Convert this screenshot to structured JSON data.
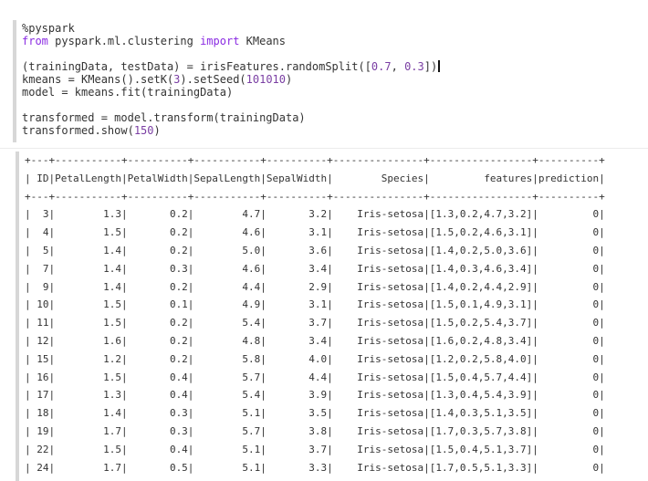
{
  "editor": {
    "lines": [
      [
        {
          "t": "%pyspark",
          "c": "fn"
        }
      ],
      [
        {
          "t": "from",
          "c": "kw"
        },
        {
          "t": " pyspark.ml.clustering ",
          "c": "fn"
        },
        {
          "t": "import",
          "c": "kw"
        },
        {
          "t": " KMeans",
          "c": "fn"
        }
      ],
      [
        {
          "t": "",
          "c": "fn"
        }
      ],
      [
        {
          "t": "(trainingData, testData) = irisFeatures.randomSplit(",
          "c": "fn"
        },
        {
          "t": "[",
          "c": "paren"
        },
        {
          "t": "0.7",
          "c": "num"
        },
        {
          "t": ", ",
          "c": "fn"
        },
        {
          "t": "0.3",
          "c": "num"
        },
        {
          "t": "])",
          "c": "paren"
        }
      ],
      [
        {
          "t": "kmeans = KMeans().setK(",
          "c": "fn"
        },
        {
          "t": "3",
          "c": "num"
        },
        {
          "t": ").setSeed(",
          "c": "fn"
        },
        {
          "t": "101010",
          "c": "num"
        },
        {
          "t": ")",
          "c": "fn"
        }
      ],
      [
        {
          "t": "model = kmeans.fit(trainingData)",
          "c": "fn"
        }
      ],
      [
        {
          "t": "",
          "c": "fn"
        }
      ],
      [
        {
          "t": "transformed = model.transform(trainingData)",
          "c": "fn"
        }
      ],
      [
        {
          "t": "transformed.show(",
          "c": "fn"
        },
        {
          "t": "150",
          "c": "num"
        },
        {
          "t": ")",
          "c": "fn"
        }
      ]
    ],
    "cursor_line": 3
  },
  "output": {
    "separator": "+---+-----------+----------+-----------+----------+---------------+-----------------+----------+",
    "header": "| ID|PetalLength|PetalWidth|SepalLength|SepalWidth|        Species|         features|prediction|",
    "rows": [
      "|  3|        1.3|       0.2|        4.7|       3.2|    Iris-setosa|[1.3,0.2,4.7,3.2]|         0|",
      "|  4|        1.5|       0.2|        4.6|       3.1|    Iris-setosa|[1.5,0.2,4.6,3.1]|         0|",
      "|  5|        1.4|       0.2|        5.0|       3.6|    Iris-setosa|[1.4,0.2,5.0,3.6]|         0|",
      "|  7|        1.4|       0.3|        4.6|       3.4|    Iris-setosa|[1.4,0.3,4.6,3.4]|         0|",
      "|  9|        1.4|       0.2|        4.4|       2.9|    Iris-setosa|[1.4,0.2,4.4,2.9]|         0|",
      "| 10|        1.5|       0.1|        4.9|       3.1|    Iris-setosa|[1.5,0.1,4.9,3.1]|         0|",
      "| 11|        1.5|       0.2|        5.4|       3.7|    Iris-setosa|[1.5,0.2,5.4,3.7]|         0|",
      "| 12|        1.6|       0.2|        4.8|       3.4|    Iris-setosa|[1.6,0.2,4.8,3.4]|         0|",
      "| 15|        1.2|       0.2|        5.8|       4.0|    Iris-setosa|[1.2,0.2,5.8,4.0]|         0|",
      "| 16|        1.5|       0.4|        5.7|       4.4|    Iris-setosa|[1.5,0.4,5.7,4.4]|         0|",
      "| 17|        1.3|       0.4|        5.4|       3.9|    Iris-setosa|[1.3,0.4,5.4,3.9]|         0|",
      "| 18|        1.4|       0.3|        5.1|       3.5|    Iris-setosa|[1.4,0.3,5.1,3.5]|         0|",
      "| 19|        1.7|       0.3|        5.7|       3.8|    Iris-setosa|[1.7,0.3,5.7,3.8]|         0|",
      "| 22|        1.5|       0.4|        5.1|       3.7|    Iris-setosa|[1.5,0.4,5.1,3.7]|         0|",
      "| 24|        1.7|       0.5|        5.1|       3.3|    Iris-setosa|[1.7,0.5,5.1,3.3]|         0|"
    ]
  },
  "colors": {
    "keyword": "#8a2be2",
    "number": "#7a3ea3",
    "text": "#333333",
    "gutter": "#d7d7d7"
  }
}
